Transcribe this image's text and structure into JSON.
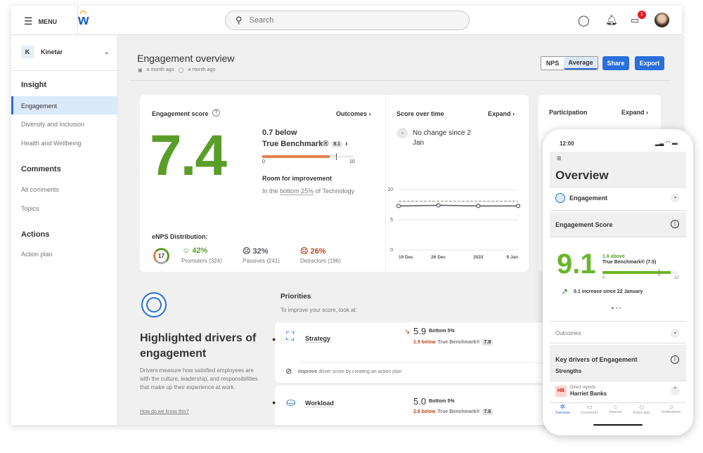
{
  "topbar": {
    "menu": "MENU",
    "search_placeholder": "Search",
    "badge": "1"
  },
  "sidebar": {
    "org_initial": "K",
    "org": "Kinetar",
    "sections": [
      {
        "title": "Insight",
        "items": [
          "Engagement",
          "Diversity and Inclusion",
          "Health and Wellbeing"
        ]
      },
      {
        "title": "Comments",
        "items": [
          "All comments",
          "Topics"
        ]
      },
      {
        "title": "Actions",
        "items": [
          "Action plan"
        ]
      }
    ]
  },
  "header": {
    "title": "Engagement overview",
    "date1": "a month ago",
    "date2": "a month ago",
    "toggle": [
      "NPS",
      "Average"
    ],
    "share": "Share",
    "export": "Export"
  },
  "score_card": {
    "title": "Engagement score",
    "outcomes": "Outcomes",
    "score": "7.4",
    "delta": "0.7 below",
    "benchmark": "True Benchmark®",
    "benchmark_value": "8.1",
    "bar_min": "0",
    "bar_max": "10",
    "score_value": 7.4,
    "room": "Room for improvement",
    "in_the": "In the",
    "bottom": "bottom 25%",
    "of": "of Technology",
    "enps_title": "eNPS Distribution:",
    "enps": "17",
    "promoters_pct": "42%",
    "promoters": "Promoters (324)",
    "passives_pct": "32%",
    "passives": "Passives (241)",
    "detractors_pct": "26%",
    "detractors": "Detractors (196)"
  },
  "score_over_time": {
    "title": "Score over time",
    "expand": "Expand",
    "dash": "-",
    "no_change": "No change since 2 Jan"
  },
  "chart_data": {
    "type": "line",
    "x": [
      "19 Dec",
      "26 Dec",
      "2022",
      "9 Jan"
    ],
    "series": [
      {
        "values": [
          7.3,
          7.4,
          7.3,
          7.3
        ]
      }
    ],
    "benchmark": 8.1,
    "yticks": [
      "0",
      "5",
      "10"
    ],
    "ylim": [
      0,
      10
    ],
    "grid": true
  },
  "participation": {
    "title": "Participation",
    "expand": "Expand"
  },
  "drivers": {
    "title": "Highlighted drivers of engagement",
    "desc": "Drivers measure how satisfied employees are with the culture, leadership, and responsibilities that make up their experience at work.",
    "link": "How do we know this?"
  },
  "priorities": {
    "title": "Priorities",
    "subtitle": "To improve your score, look at:",
    "items": [
      {
        "name": "Strategy",
        "score": "5.9",
        "rank": "Bottom 5%",
        "below": "1.9 below",
        "bench": "True Benchmark®",
        "bench_val": "7.8",
        "action_bold": "Improve",
        "action": "driver score by creating an action plan"
      },
      {
        "name": "Workload",
        "score": "5.0",
        "rank": "Bottom 5%",
        "below": "2.6 below",
        "bench": "True Benchmark®",
        "bench_val": "7.6"
      }
    ]
  },
  "phone": {
    "time": "12:00",
    "title": "Overview",
    "engagement": "Engagement",
    "score_title": "Engagement Score",
    "score": "9.1",
    "above": "1.6 above",
    "bench": "True Benchmark® (7.5)",
    "min": "0",
    "max": "10",
    "score_value": 9.1,
    "increase": "0.1 increase since 22 January",
    "outcomes": "Outcomes",
    "drivers": "Key drivers of Engagement",
    "strengths": "Strengths",
    "report_initials": "HB",
    "report_label": "Direct reports",
    "report_name": "Harriet Banks",
    "nav": [
      "Overview",
      "Comments",
      "Improve",
      "Action plan",
      "Notifications"
    ]
  },
  "colors": {
    "accent": "#2a6fdb",
    "green": "#5a9e2a",
    "orange": "#e8804f",
    "red": "#c0441c"
  }
}
